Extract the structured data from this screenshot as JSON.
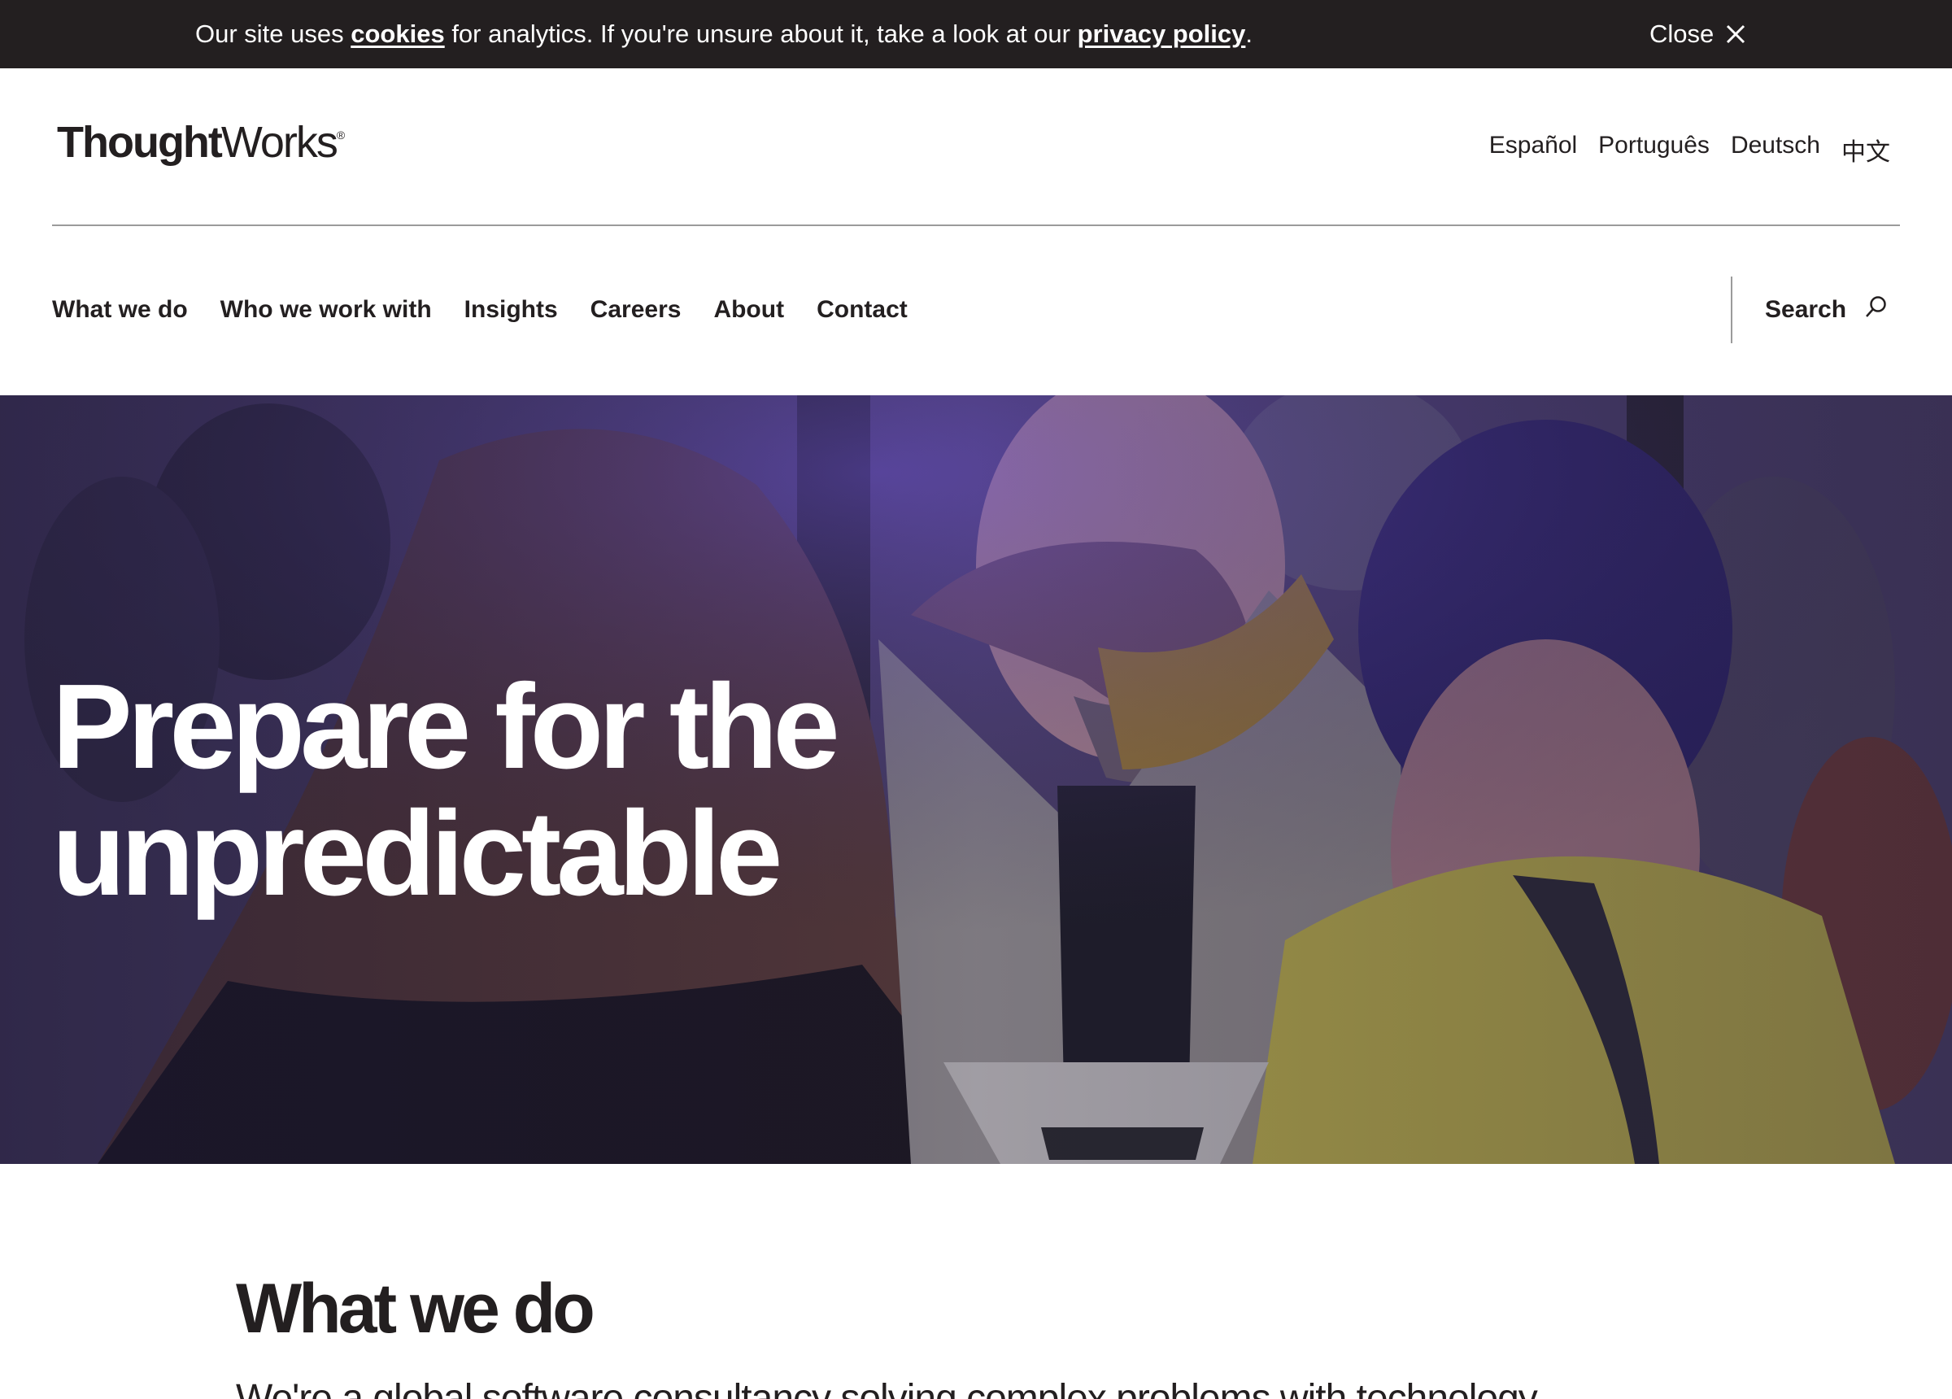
{
  "cookie_banner": {
    "text_before": "Our site uses ",
    "cookies_link": "cookies",
    "text_middle": " for analytics. If you're unsure about it, take a look at our ",
    "privacy_link": "privacy policy",
    "text_after": ".",
    "close_label": "Close",
    "close_icon": "close-icon"
  },
  "header": {
    "logo_part1": "Thought",
    "logo_part2": "Works",
    "logo_mark": "®",
    "languages": [
      "Español",
      "Português",
      "Deutsch",
      "中文"
    ]
  },
  "nav": {
    "items": [
      "What we do",
      "Who we work with",
      "Insights",
      "Careers",
      "About",
      "Contact"
    ],
    "search_label": "Search",
    "search_icon": "search-icon"
  },
  "hero": {
    "title_line1": "Prepare for the",
    "title_line2": "unpredictable"
  },
  "what_we_do": {
    "title": "What we do",
    "lead": "We're a global software consultancy solving complex problems with technology"
  },
  "colors": {
    "cookie_bar_bg": "#231f20",
    "text": "#231f20",
    "hero_tint": "#5a4a8a",
    "divider": "#9b9b9b"
  }
}
